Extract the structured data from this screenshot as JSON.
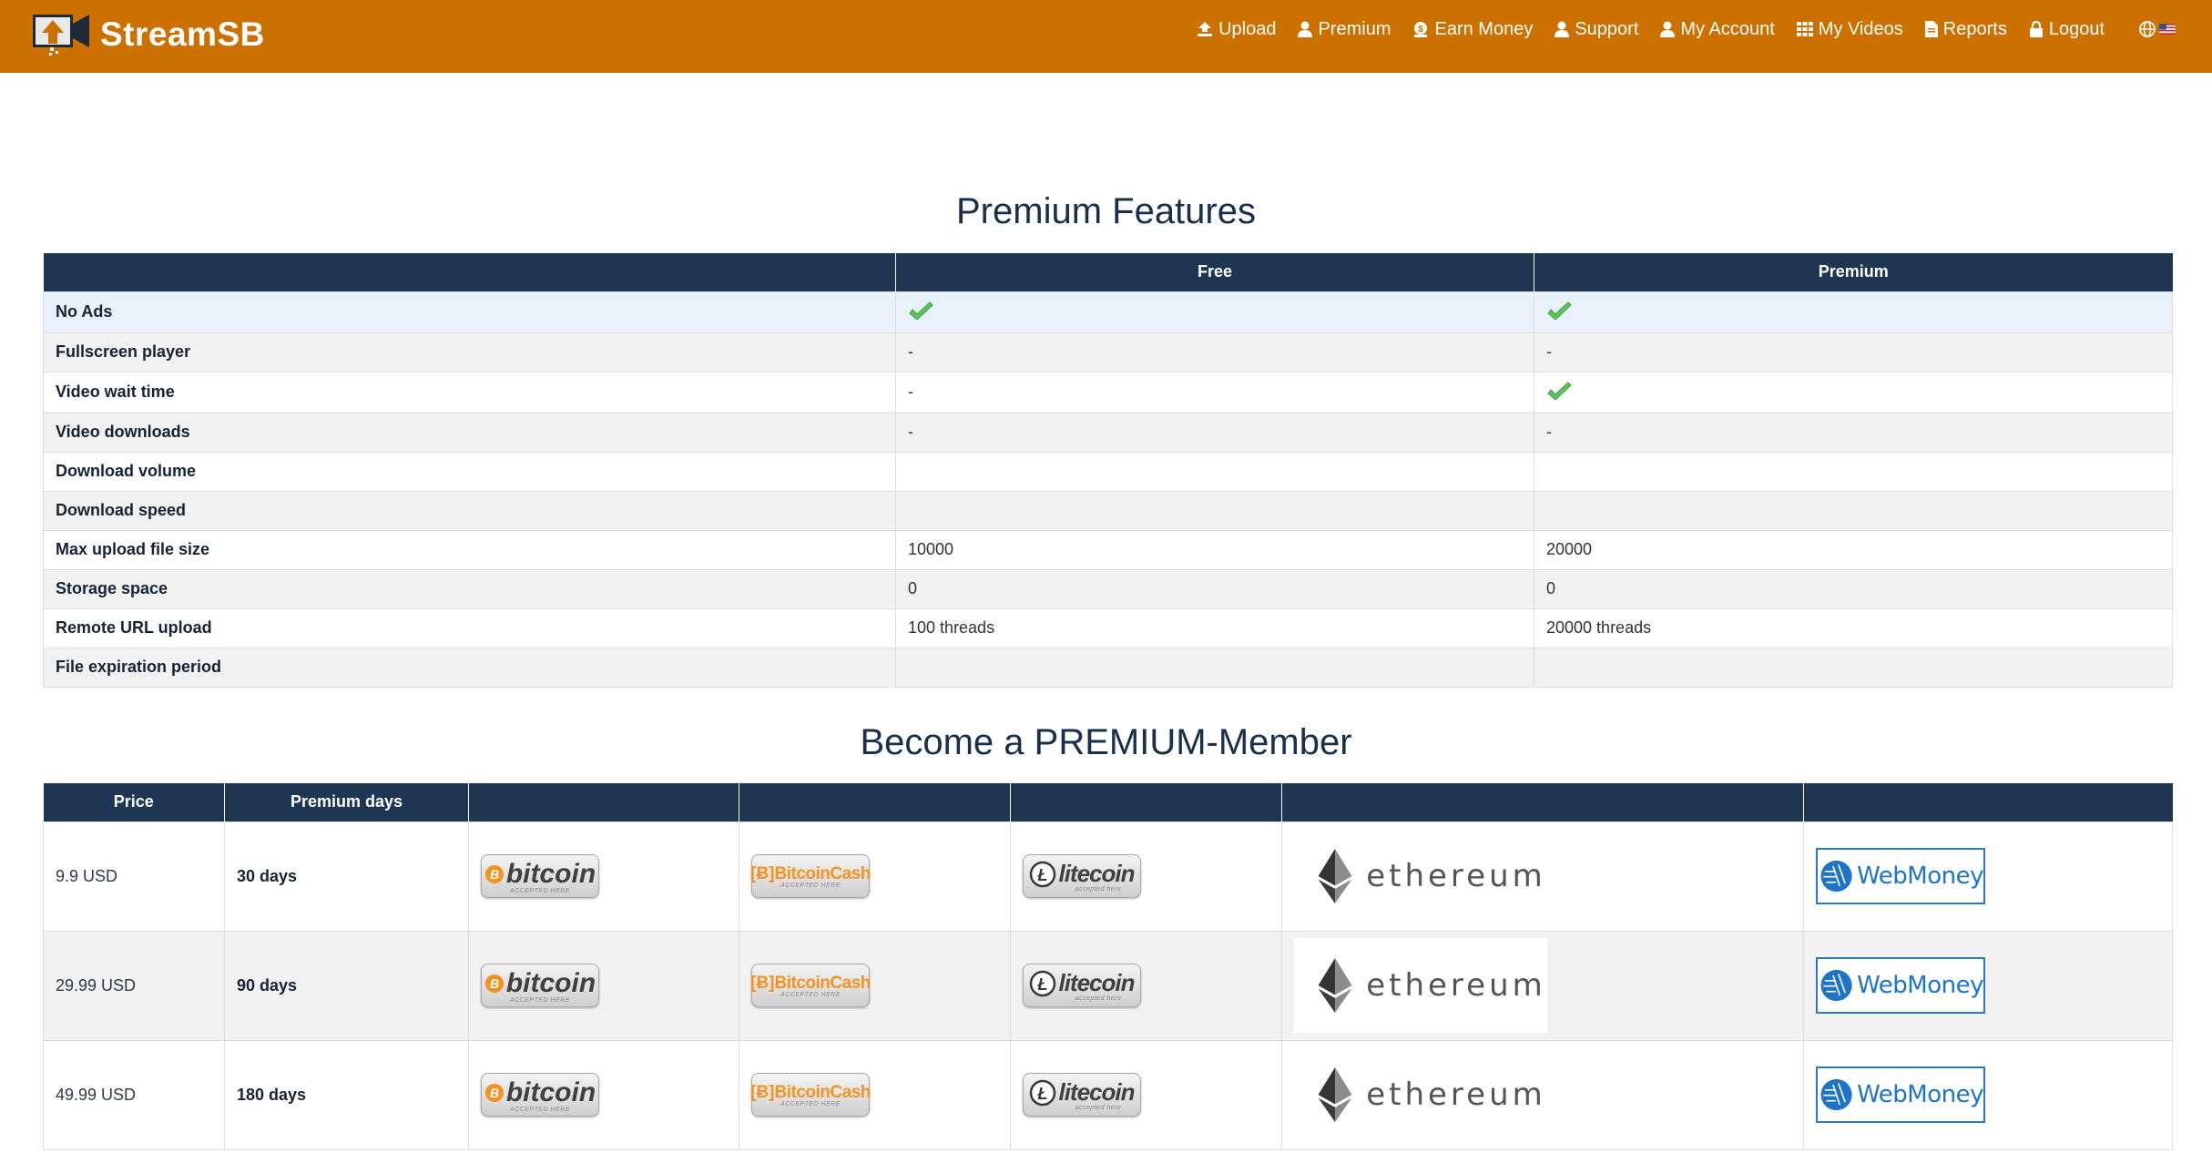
{
  "header": {
    "brand": "StreamSB",
    "nav": [
      {
        "label": "Upload",
        "icon": "upload-icon"
      },
      {
        "label": "Premium",
        "icon": "user-icon"
      },
      {
        "label": "Earn Money",
        "icon": "money-icon"
      },
      {
        "label": "Support",
        "icon": "user-icon"
      },
      {
        "label": "My Account",
        "icon": "user-icon"
      },
      {
        "label": "My Videos",
        "icon": "grid-icon"
      },
      {
        "label": "Reports",
        "icon": "file-icon"
      },
      {
        "label": "Logout",
        "icon": "lock-icon"
      }
    ],
    "lang_icon": "globe-icon",
    "flag_icon": "us-flag-icon"
  },
  "features": {
    "title": "Premium Features",
    "columns": [
      "",
      "Free",
      "Premium"
    ],
    "rows": [
      {
        "label": "No Ads",
        "free": "",
        "premium": "",
        "free_check": true,
        "premium_check": true
      },
      {
        "label": "Fullscreen player",
        "free": "-",
        "premium": "-",
        "free_check": false,
        "premium_check": false
      },
      {
        "label": "Video wait time",
        "free": "-",
        "premium": "",
        "free_check": false,
        "premium_check": true
      },
      {
        "label": "Video downloads",
        "free": "-",
        "premium": "-",
        "free_check": false,
        "premium_check": false
      },
      {
        "label": "Download volume",
        "free": "",
        "premium": "",
        "free_check": false,
        "premium_check": false
      },
      {
        "label": "Download speed",
        "free": "",
        "premium": "",
        "free_check": false,
        "premium_check": false
      },
      {
        "label": "Max upload file size",
        "free": "10000",
        "premium": "20000",
        "free_check": false,
        "premium_check": false
      },
      {
        "label": "Storage space",
        "free": "0",
        "premium": "0",
        "free_check": false,
        "premium_check": false
      },
      {
        "label": "Remote URL upload",
        "free": "100 threads",
        "premium": "20000 threads",
        "free_check": false,
        "premium_check": false
      },
      {
        "label": "File expiration period",
        "free": "",
        "premium": "",
        "free_check": false,
        "premium_check": false
      }
    ]
  },
  "plans": {
    "title": "Become a PREMIUM-Member",
    "columns": [
      "Price",
      "Premium days",
      "",
      "",
      "",
      "",
      ""
    ],
    "methods": {
      "bitcoin": {
        "word": "bitcoin",
        "sub": "ACCEPTED HERE"
      },
      "bitcoincash": {
        "prefix": "[Ƀ]",
        "word": "BitcoinCash",
        "sub": "ACCEPTED HERE"
      },
      "litecoin": {
        "word": "litecoin",
        "sub": "accepted here"
      },
      "ethereum": {
        "word": "ethereum"
      },
      "webmoney": {
        "word": "WebMoney"
      }
    },
    "rows": [
      {
        "price": "9.9 USD",
        "days": "30 days"
      },
      {
        "price": "29.99 USD",
        "days": "90 days"
      },
      {
        "price": "49.99 USD",
        "days": "180 days"
      }
    ]
  },
  "colors": {
    "header_bg": "#cc7000",
    "table_header_bg": "#1e3651",
    "check_green": "#5cc45c",
    "webmoney_blue": "#1e74c6",
    "bitcoin_orange": "#f39322"
  }
}
